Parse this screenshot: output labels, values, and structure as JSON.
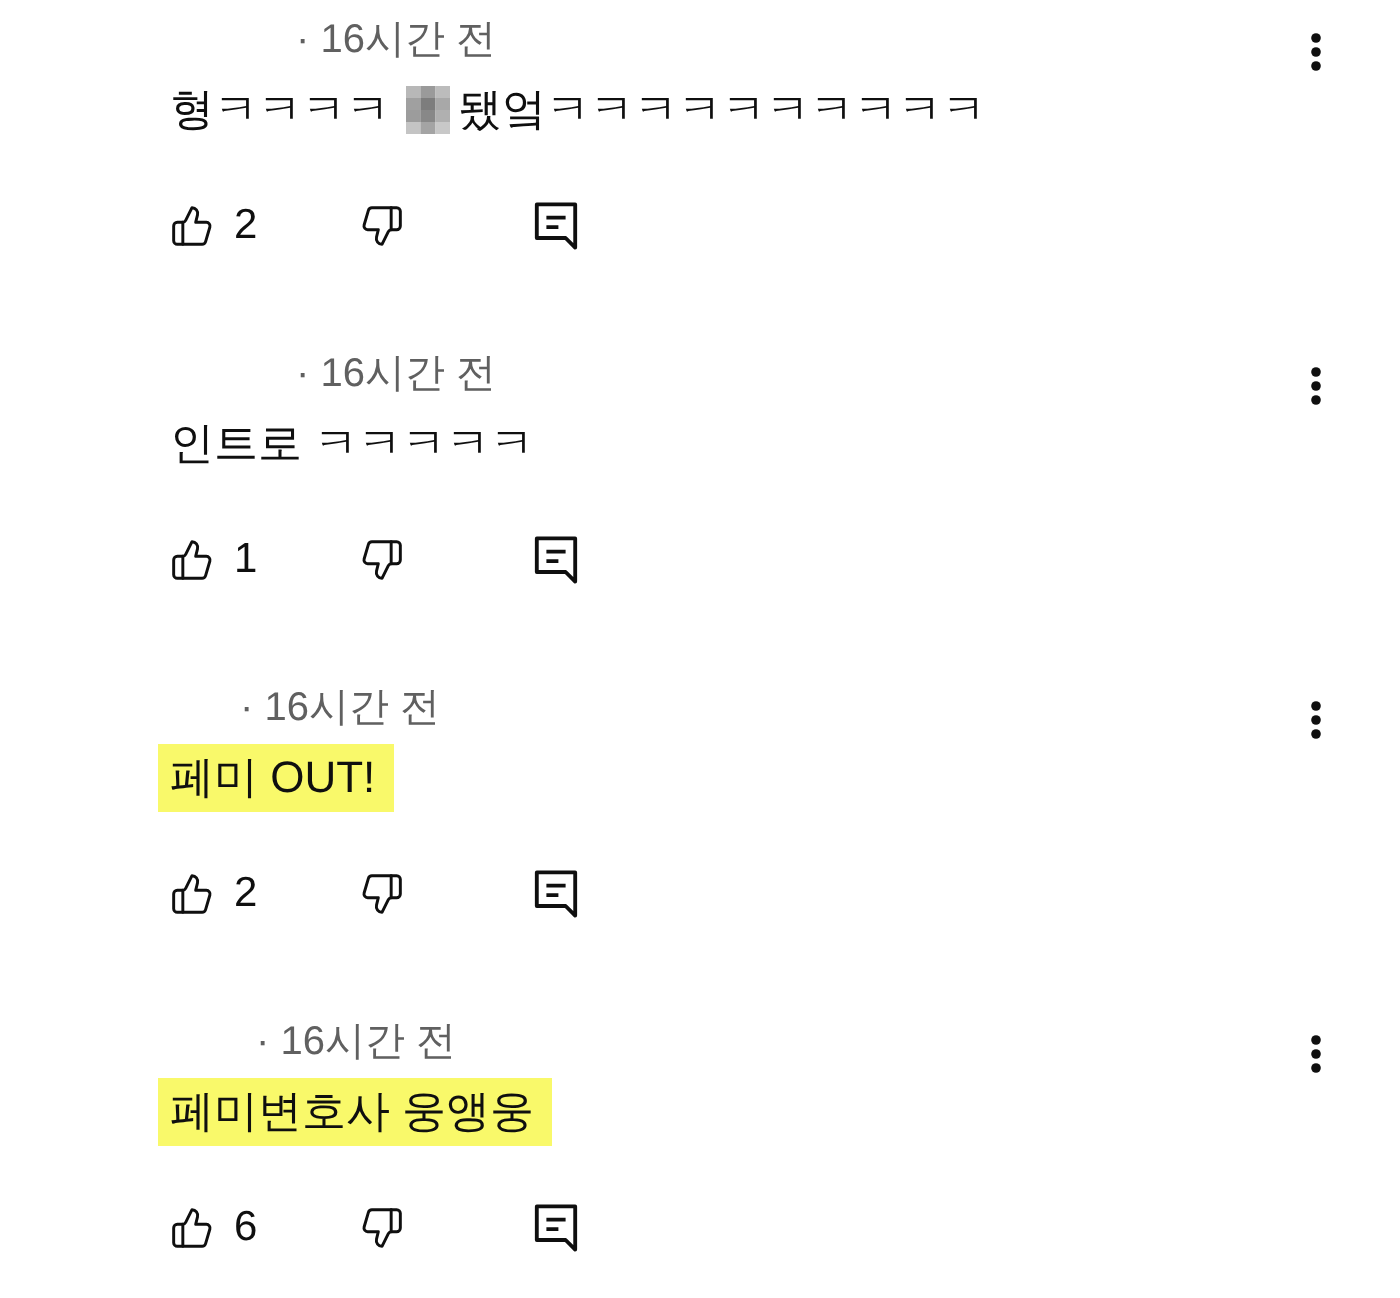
{
  "comments": [
    {
      "timestamp": "· 16시간 전",
      "body": [
        {
          "kind": "text",
          "text": "형ㅋㅋㅋㅋ "
        },
        {
          "kind": "censored"
        },
        {
          "kind": "text",
          "text": "됐엌ㅋㅋㅋㅋㅋㅋㅋㅋㅋㅋ"
        }
      ],
      "highlighted": false,
      "likes": "2"
    },
    {
      "timestamp": "· 16시간 전",
      "body": [
        {
          "kind": "text",
          "text": "인트로 ㅋㅋㅋㅋㅋ"
        }
      ],
      "highlighted": false,
      "likes": "1"
    },
    {
      "timestamp": "· 16시간 전",
      "body": [
        {
          "kind": "text",
          "text": "페미 OUT!"
        }
      ],
      "highlighted": true,
      "likes": "2"
    },
    {
      "timestamp": "· 16시간 전",
      "body": [
        {
          "kind": "text",
          "text": "페미변호사 웅앵웅"
        }
      ],
      "highlighted": true,
      "likes": "6"
    }
  ]
}
